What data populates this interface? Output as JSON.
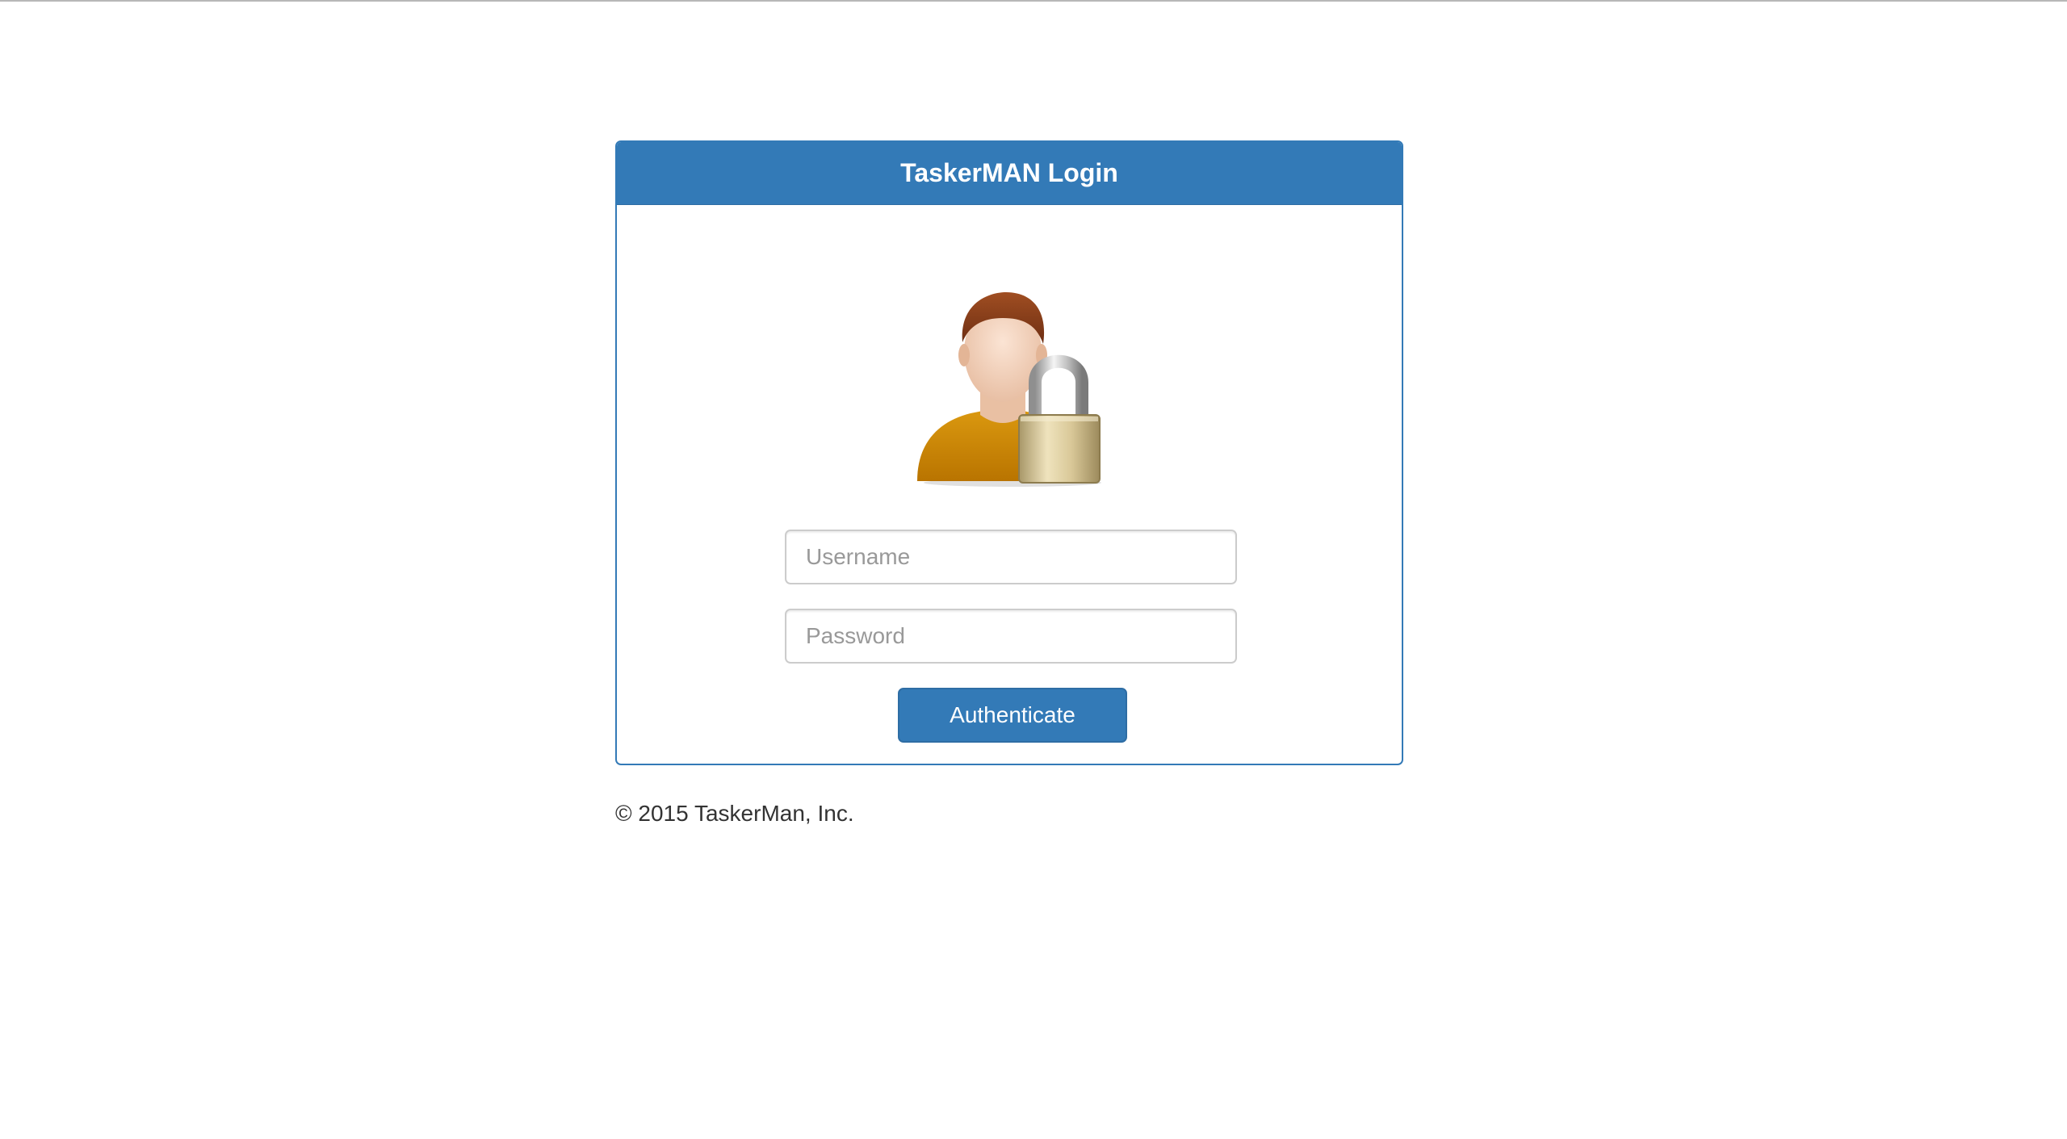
{
  "login": {
    "title": "TaskerMAN Login",
    "avatar_icon": "user-lock-icon",
    "username_placeholder": "Username",
    "password_placeholder": "Password",
    "submit_label": "Authenticate"
  },
  "footer": {
    "copyright": "© 2015 TaskerMan, Inc."
  },
  "colors": {
    "primary": "#337ab7",
    "primary_border": "#2e6da4",
    "input_border": "#cccccc",
    "avatar_shirt": "#d08a0a",
    "avatar_hair": "#8a3f1c",
    "lock_body": "#c8b98a"
  }
}
